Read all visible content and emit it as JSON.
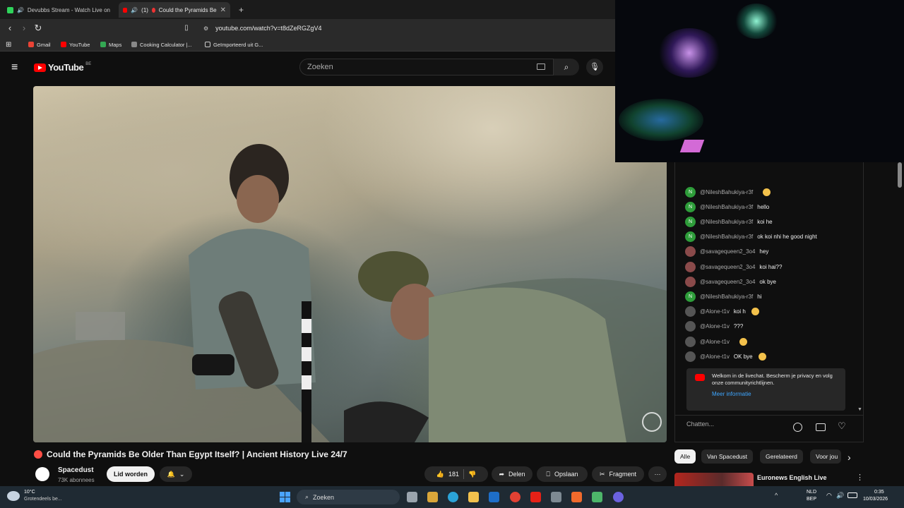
{
  "browser": {
    "tabs": [
      {
        "label": "Devubbs Stream - Watch Live on",
        "active": false
      },
      {
        "label": "Could the Pyramids Be",
        "prefix": "(1)",
        "active": true
      }
    ],
    "new_tab": "+",
    "url": "youtube.com/watch?v=t8dZeRGZgV4",
    "bookmarks": [
      "Gmail",
      "YouTube",
      "Maps",
      "Cooking Calculator |...",
      "Geïmporteerd uit G..."
    ]
  },
  "youtube": {
    "logo": "YouTube",
    "country": "BE",
    "search_placeholder": "Zoeken"
  },
  "video": {
    "title": "Could the Pyramids Be Older Than Egypt Itself? | Ancient History Live 24/7",
    "channel": "Spacedust",
    "subscribers": "73K abonnees",
    "join_label": "Lid worden",
    "like_count": "181",
    "share_label": "Delen",
    "save_label": "Opslaan",
    "clip_label": "Fragment",
    "more_label": "···"
  },
  "chat": {
    "messages": [
      {
        "author": "@NileshBahukiya-r3f",
        "text": "",
        "emoji": true,
        "avatar": "N",
        "color": "#2e9d3a"
      },
      {
        "author": "@NileshBahukiya-r3f",
        "text": "hello",
        "emoji": false,
        "avatar": "N",
        "color": "#2e9d3a"
      },
      {
        "author": "@NileshBahukiya-r3f",
        "text": "koi he",
        "emoji": false,
        "avatar": "N",
        "color": "#2e9d3a"
      },
      {
        "author": "@NileshBahukiya-r3f",
        "text": "ok koi nhi he good night",
        "emoji": false,
        "avatar": "N",
        "color": "#2e9d3a"
      },
      {
        "author": "@savagequeen2_3o4",
        "text": "hey",
        "emoji": false,
        "avatar": "",
        "color": "#8a4a4a"
      },
      {
        "author": "@savagequeen2_3o4",
        "text": "koi hai??",
        "emoji": false,
        "avatar": "",
        "color": "#8a4a4a"
      },
      {
        "author": "@savagequeen2_3o4",
        "text": "ok bye",
        "emoji": false,
        "avatar": "",
        "color": "#8a4a4a"
      },
      {
        "author": "@NileshBahukiya-r3f",
        "text": "hi",
        "emoji": false,
        "avatar": "N",
        "color": "#2e9d3a"
      },
      {
        "author": "@Alone-t1v",
        "text": "koi h",
        "emoji": true,
        "avatar": "",
        "color": "#555"
      },
      {
        "author": "@Alone-t1v",
        "text": "???",
        "emoji": false,
        "avatar": "",
        "color": "#555"
      },
      {
        "author": "@Alone-t1v",
        "text": "",
        "emoji": true,
        "avatar": "",
        "color": "#555"
      },
      {
        "author": "@Alone-t1v",
        "text": "OK bye",
        "emoji": true,
        "avatar": "",
        "color": "#555"
      }
    ],
    "welcome_text": "Welkom in de livechat. Bescherm je privacy en volg onze communityrichtlijnen.",
    "welcome_link": "Meer informatie",
    "input_placeholder": "Chatten..."
  },
  "chips": [
    "Alle",
    "Van Spacedust",
    "Gerelateerd",
    "Voor jou"
  ],
  "related": {
    "title": "Euronews English Live"
  },
  "taskbar": {
    "weather_temp": "10°C",
    "weather_desc": "Grotendeels be...",
    "search": "Zoeken",
    "lang": "NLD",
    "lang_sub": "BEP",
    "time": "0:35",
    "date": "10/03/2026"
  }
}
